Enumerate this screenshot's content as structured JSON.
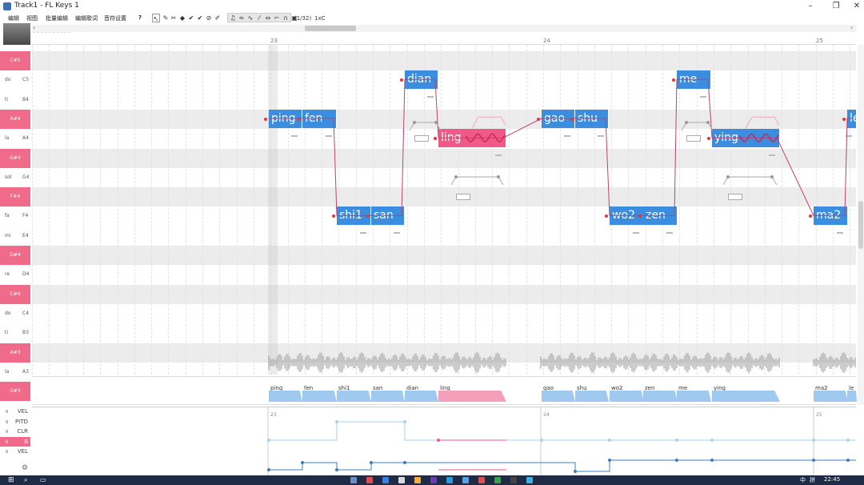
{
  "window": {
    "title": "Track1 - FL Keys 1",
    "minimize": "–",
    "maximize": "❐",
    "close": "✕"
  },
  "menu": [
    "编辑",
    "视图",
    "批量编辑",
    "编辑歌词",
    "音符设置"
  ],
  "toolbar": {
    "help": "?",
    "quantize": "(1/32)",
    "key": "1xC"
  },
  "watermark": "bilibili",
  "ruler": {
    "bars": [
      "23",
      "24",
      "25"
    ]
  },
  "keys": [
    {
      "solfege": "",
      "note": "C#5",
      "black": true
    },
    {
      "solfege": "do",
      "note": "C5",
      "black": false
    },
    {
      "solfege": "ti",
      "note": "B4",
      "black": false
    },
    {
      "solfege": "",
      "note": "A#4",
      "black": true
    },
    {
      "solfege": "la",
      "note": "A4",
      "black": false
    },
    {
      "solfege": "",
      "note": "G#4",
      "black": true
    },
    {
      "solfege": "sol",
      "note": "G4",
      "black": false
    },
    {
      "solfege": "",
      "note": "F#4",
      "black": true
    },
    {
      "solfege": "fa",
      "note": "F4",
      "black": false
    },
    {
      "solfege": "mi",
      "note": "E4",
      "black": false
    },
    {
      "solfege": "",
      "note": "D#4",
      "black": true
    },
    {
      "solfege": "re",
      "note": "D4",
      "black": false
    },
    {
      "solfege": "",
      "note": "C#4",
      "black": true
    },
    {
      "solfege": "do",
      "note": "C4",
      "black": false
    },
    {
      "solfege": "ti",
      "note": "B3",
      "black": false
    },
    {
      "solfege": "",
      "note": "A#3",
      "black": true
    },
    {
      "solfege": "la",
      "note": "A3",
      "black": false
    },
    {
      "solfege": "",
      "note": "G#3",
      "black": true
    }
  ],
  "notes": [
    {
      "lyric": "ping",
      "pitch": "A#4"
    },
    {
      "lyric": "fen",
      "pitch": "A#4"
    },
    {
      "lyric": "shi1",
      "pitch": "F4"
    },
    {
      "lyric": "san",
      "pitch": "F4"
    },
    {
      "lyric": "dian",
      "pitch": "C5"
    },
    {
      "lyric": "ling",
      "pitch": "A4",
      "selected": true
    },
    {
      "lyric": "gao",
      "pitch": "A#4"
    },
    {
      "lyric": "shu",
      "pitch": "A#4"
    },
    {
      "lyric": "wo2",
      "pitch": "F4"
    },
    {
      "lyric": "zen",
      "pitch": "F4"
    },
    {
      "lyric": "me",
      "pitch": "C5"
    },
    {
      "lyric": "ying",
      "pitch": "A4"
    },
    {
      "lyric": "ma2",
      "pitch": "F4"
    },
    {
      "lyric": "le",
      "pitch": "A#4"
    }
  ],
  "lyricsTrack": [
    "ping",
    "fen",
    "shi1",
    "san",
    "dian",
    "ling",
    "gao",
    "shu",
    "wo2",
    "zen",
    "me",
    "ying",
    "ma2",
    "le"
  ],
  "params": [
    {
      "label": "VEL",
      "selected": false
    },
    {
      "label": "PITD",
      "selected": false
    },
    {
      "label": "CLR",
      "selected": false
    },
    {
      "label": "B",
      "selected": true
    },
    {
      "label": "VEL",
      "selected": false
    }
  ],
  "taskbar": {
    "ime": "中",
    "time": "22:45",
    "lang": "拼"
  },
  "colors": {
    "note": "#3b8de0",
    "selected": "#f05a89",
    "key_black": "#f06a8a"
  }
}
